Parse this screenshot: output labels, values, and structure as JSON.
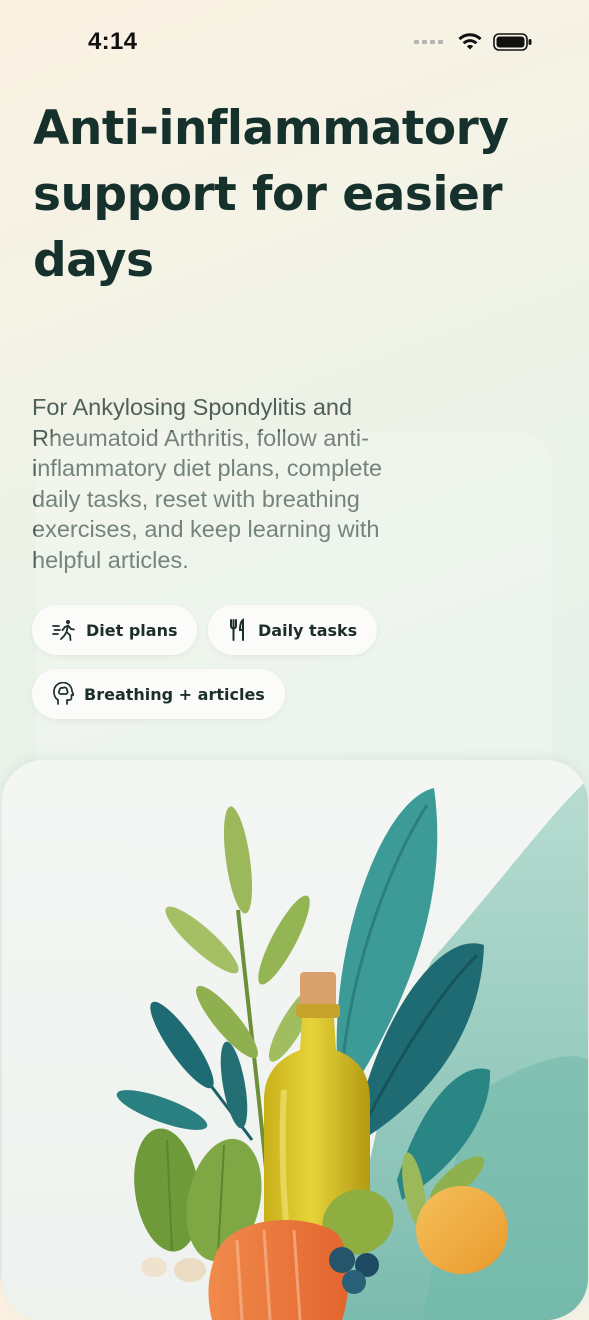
{
  "status_bar": {
    "time": "4:14"
  },
  "hero": {
    "headline": "Anti-inflammatory support for easier days",
    "subtitle": "For Ankylosing Spondylitis and Rheumatoid Arthritis, follow anti-inflammatory diet plans, complete daily tasks, reset with breathing exercises, and keep learning with helpful articles."
  },
  "features": [
    {
      "label": "Diet plans",
      "icon": "running-person-icon"
    },
    {
      "label": "Daily tasks",
      "icon": "fork-knife-icon"
    },
    {
      "label": "Breathing + articles",
      "icon": "head-brain-icon"
    }
  ],
  "illustration": {
    "subject": "olive oil bottle with leaves, greens and fruit"
  },
  "colors": {
    "headline": "#16302b",
    "body": "#4f605c",
    "accent_teal": "#2f8a86"
  }
}
